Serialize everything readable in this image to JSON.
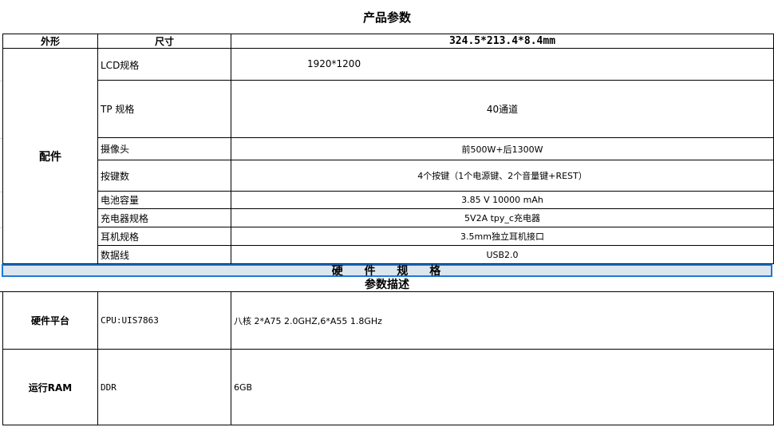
{
  "title": "产品参数",
  "header": {
    "col1": "外形",
    "col2": "尺寸",
    "col3": "324.5*213.4*8.4mm"
  },
  "accessories": {
    "group_label": "配件",
    "rows": [
      {
        "name": "LCD规格",
        "value": "1920*1200"
      },
      {
        "name": "TP 规格",
        "value": "40通道"
      },
      {
        "name": "摄像头",
        "value": "前500W+后1300W"
      },
      {
        "name": "按键数",
        "value": "4个按键（1个电源键、2个音量键+REST）"
      },
      {
        "name": "电池容量",
        "value": "3.85 V 10000 mAh"
      },
      {
        "name": "充电器规格",
        "value": "5V2A tpy_c充电器"
      },
      {
        "name": "耳机规格",
        "value": "3.5mm独立耳机接口"
      },
      {
        "name": "数据线",
        "value": "USB2.0"
      }
    ]
  },
  "hardware_section": "硬 件 规 格",
  "param_desc": "参数描述",
  "hardware": [
    {
      "label": "硬件平台",
      "name": "CPU:UIS7863",
      "value": "八核 2*A75 2.0GHZ,6*A55 1.8GHz"
    },
    {
      "label": "运行RAM",
      "name": "DDR",
      "value": "6GB"
    }
  ]
}
